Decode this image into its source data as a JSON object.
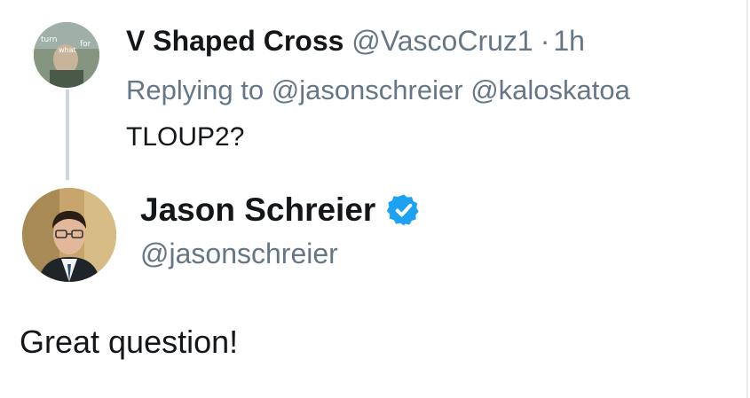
{
  "parent_tweet": {
    "avatar_text": [
      "turn",
      "for",
      "what"
    ],
    "display_name": "V Shaped Cross",
    "handle": "@VascoCruz1",
    "separator": "·",
    "time": "1h",
    "replying_prefix": "Replying to",
    "mentions": [
      "@jasonschreier",
      "@kaloskatoa"
    ],
    "body": "TLOUP2?"
  },
  "main_tweet": {
    "display_name": "Jason Schreier",
    "handle": "@jasonschreier",
    "verified_icon": "verified-badge-icon",
    "body": "Great question!"
  },
  "colors": {
    "text_primary": "#14171a",
    "text_secondary": "#657786",
    "verified_blue": "#1da1f2",
    "thread_line": "#ccd6dd"
  }
}
